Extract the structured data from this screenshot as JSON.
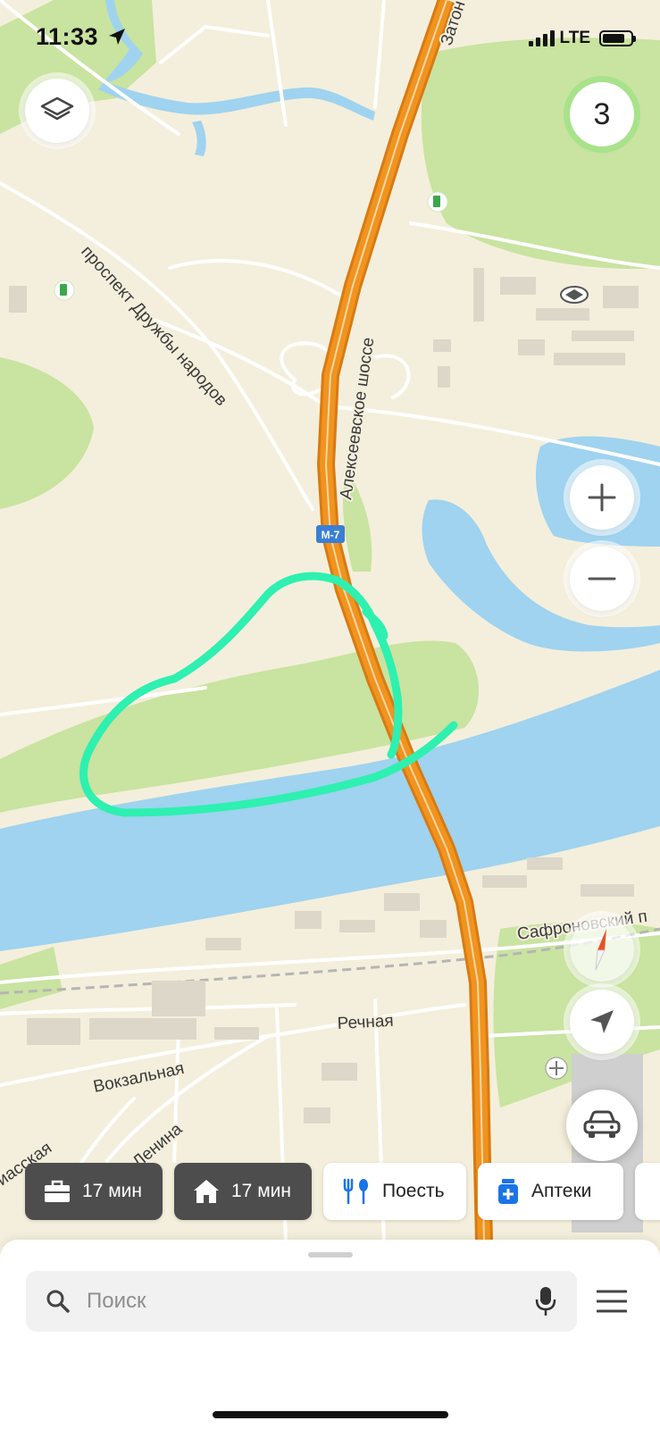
{
  "status_bar": {
    "time": "11:33",
    "network": "LTE"
  },
  "map": {
    "labels": {
      "road_top": "Затон",
      "prospekt": "проспект Дружбы народов",
      "highway": "Алексеевское шоссе",
      "route_shield": "М-7",
      "safronovsky": "Сафроновский п",
      "rechnaya": "Речная",
      "vokzalnaya": "Вокзальная",
      "lenina": "Ленина",
      "miasskaya": "иасская"
    },
    "colors": {
      "land": "#f4efdc",
      "park": "#c9e3a0",
      "water": "#9fd3ef",
      "highway": "#f0941f",
      "annotation": "#2ef0b0"
    }
  },
  "controls": {
    "traffic_level": "3",
    "icons": {
      "layers": "layers-icon",
      "zoom_in": "plus-icon",
      "zoom_out": "minus-icon",
      "compass": "compass-icon",
      "locate": "location-arrow-icon",
      "transport": "car-icon"
    }
  },
  "chips": [
    {
      "icon": "briefcase-icon",
      "label": "17 мин"
    },
    {
      "icon": "home-icon",
      "label": "17 мин"
    },
    {
      "icon": "food-icon",
      "label": "Поесть"
    },
    {
      "icon": "pharmacy-icon",
      "label": "Аптеки"
    }
  ],
  "search": {
    "placeholder": "Поиск",
    "icons": {
      "search": "search-icon",
      "voice": "microphone-icon",
      "menu": "menu-icon"
    }
  }
}
